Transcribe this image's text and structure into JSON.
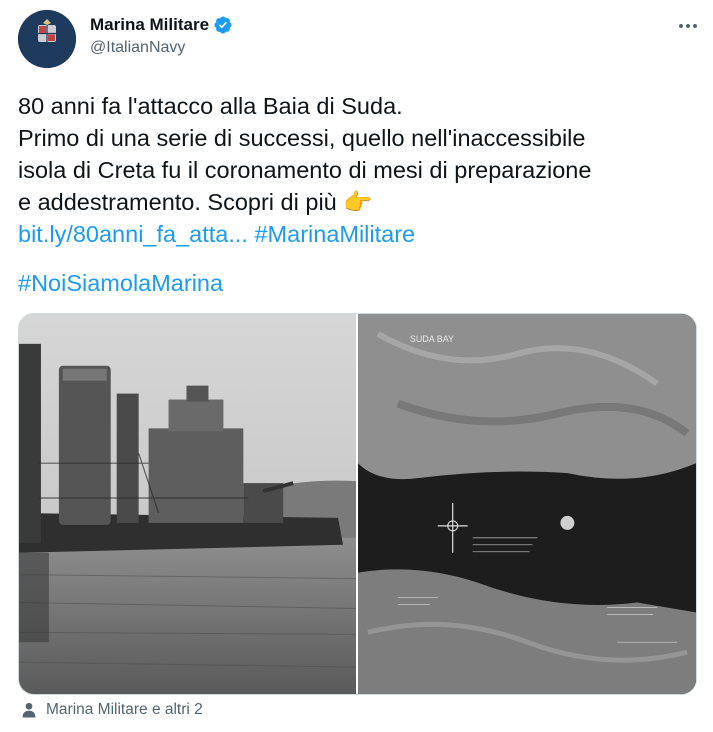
{
  "account": {
    "display_name": "Marina Militare",
    "handle": "@ItalianNavy",
    "avatar_text_line1": "MARINA",
    "avatar_text_line2": "MILITARE"
  },
  "tweet": {
    "line1": "80 anni fa l'attacco alla Baia di Suda.",
    "line2": "Primo di una serie di successi, quello nell'inaccessibile",
    "line3": "isola di Creta fu il coronamento di mesi di preparazione",
    "line4": "e addestramento. Scopri di più 👉",
    "link": "bit.ly/80anni_fa_atta...",
    "hashtag1": "#MarinaMilitare",
    "hashtag2": "#NoiSiamolaMarina"
  },
  "media": {
    "map_label": "SUDA BAY"
  },
  "footer": {
    "tagged_text": "Marina Militare e altri 2"
  },
  "colors": {
    "link": "#1d9bf0",
    "verified": "#1d9bf0",
    "secondary_text": "#536471"
  },
  "icons": {
    "verified": "verified-badge-icon",
    "more": "more-horizontal-icon",
    "tagged": "person-icon"
  }
}
